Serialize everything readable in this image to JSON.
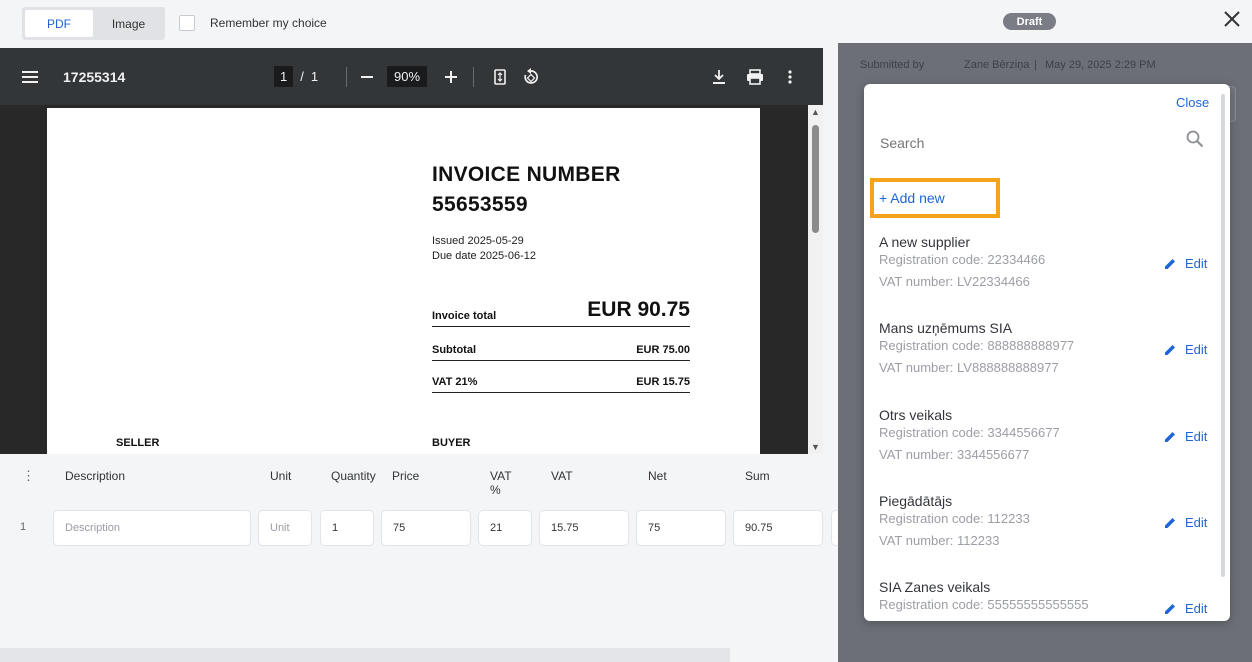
{
  "toggle": {
    "pdf_label": "PDF",
    "image_label": "Image",
    "remember_label": "Remember my choice"
  },
  "viewer": {
    "file_name": "17255314",
    "current_page": "1",
    "page_sep": "/",
    "total_pages": "1",
    "zoom": "90%"
  },
  "invoice": {
    "title_line1": "INVOICE NUMBER",
    "title_line2": "55653559",
    "issued": "Issued 2025-05-29",
    "due": "Due date 2025-06-12",
    "total_label": "Invoice total",
    "total_value": "EUR 90.75",
    "subtotal_label": "Subtotal",
    "subtotal_value": "EUR 75.00",
    "vat_label": "VAT 21%",
    "vat_value": "EUR 15.75",
    "seller_label": "SELLER",
    "buyer_label": "BUYER"
  },
  "items": {
    "headers": {
      "description": "Description",
      "unit": "Unit",
      "quantity": "Quantity",
      "price": "Price",
      "vat_pct_line1": "VAT",
      "vat_pct_line2": "%",
      "vat": "VAT",
      "net": "Net",
      "sum": "Sum"
    },
    "row": {
      "number": "1",
      "description_placeholder": "Description",
      "unit_placeholder": "Unit",
      "quantity": "1",
      "price": "75",
      "vat_pct": "21",
      "vat": "15.75",
      "net": "75",
      "sum": "90.75"
    }
  },
  "panel": {
    "status": "Draft",
    "submitted_by_label": "Submitted by",
    "submitted_by_value": "Zane Bērziņa",
    "submitted_sep": "|",
    "submitted_at": "May 29, 2025 2:29 PM"
  },
  "supplier_dropdown": {
    "close_label": "Close",
    "search_placeholder": "Search",
    "add_new_label": "+ Add new",
    "edit_label": "Edit",
    "suppliers": [
      {
        "name": "A new supplier",
        "reg": "Registration code: 22334466",
        "vat": "VAT number: LV22334466"
      },
      {
        "name": "Mans uzņēmums SIA",
        "reg": "Registration code: 888888888977",
        "vat": "VAT number: LV888888888977"
      },
      {
        "name": "Otrs veikals",
        "reg": "Registration code: 3344556677",
        "vat": "VAT number: 3344556677"
      },
      {
        "name": "Piegādātājs",
        "reg": "Registration code: 112233",
        "vat": "VAT number: 112233"
      },
      {
        "name": "SIA Zanes veikals",
        "reg": "Registration code: 55555555555555",
        "vat": ""
      }
    ]
  },
  "colors": {
    "accent": "#1e66d6",
    "highlight": "#f4a41b",
    "overlay": "#6d6f78"
  }
}
